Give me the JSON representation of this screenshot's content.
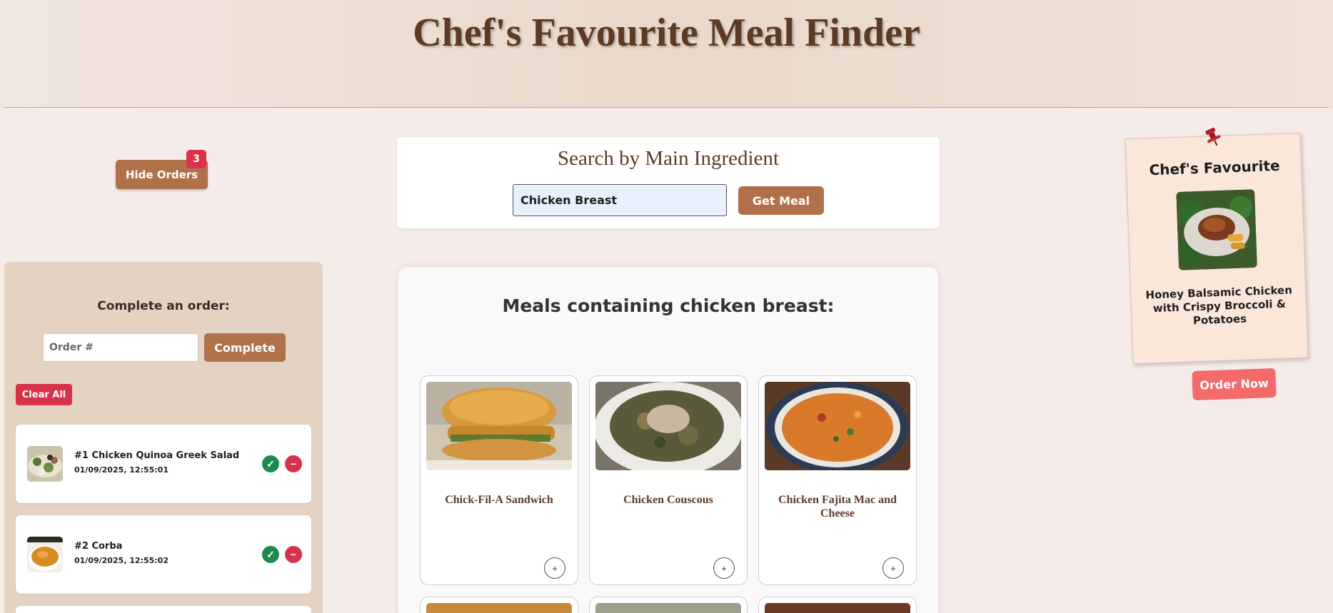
{
  "header": {
    "title": "Chef's Favourite Meal Finder"
  },
  "orders_toggle": {
    "label": "Hide Orders",
    "count": "3"
  },
  "orders_panel": {
    "heading": "Complete an order:",
    "input_placeholder": "Order #",
    "complete_label": "Complete",
    "clear_all_label": "Clear All",
    "orders": [
      {
        "title": "#1 Chicken Quinoa Greek Salad",
        "time": "01/09/2025, 12:55:01"
      },
      {
        "title": "#2 Corba",
        "time": "01/09/2025, 12:55:02"
      }
    ]
  },
  "search": {
    "heading": "Search by Main Ingredient",
    "input_value": "Chicken Breast",
    "button_label": "Get Meal"
  },
  "results": {
    "heading": "Meals containing chicken breast:",
    "meals": [
      {
        "name": "Chick-Fil-A Sandwich",
        "add_icon": "+"
      },
      {
        "name": "Chicken Couscous",
        "add_icon": "+"
      },
      {
        "name": "Chicken Fajita Mac and Cheese",
        "add_icon": "+"
      }
    ]
  },
  "favourite": {
    "heading": "Chef's Favourite",
    "meal_name": "Honey Balsamic Chicken with Crispy Broccoli & Potatoes",
    "order_label": "Order Now"
  },
  "icons": {
    "check": "✓",
    "remove": "−",
    "add": "+"
  },
  "colors": {
    "accent_brown": "#b0704a",
    "danger_red": "#d7324a",
    "success_green": "#1f8a4c",
    "order_now_red": "#f26a6a",
    "title_brown": "#5c3a26"
  }
}
